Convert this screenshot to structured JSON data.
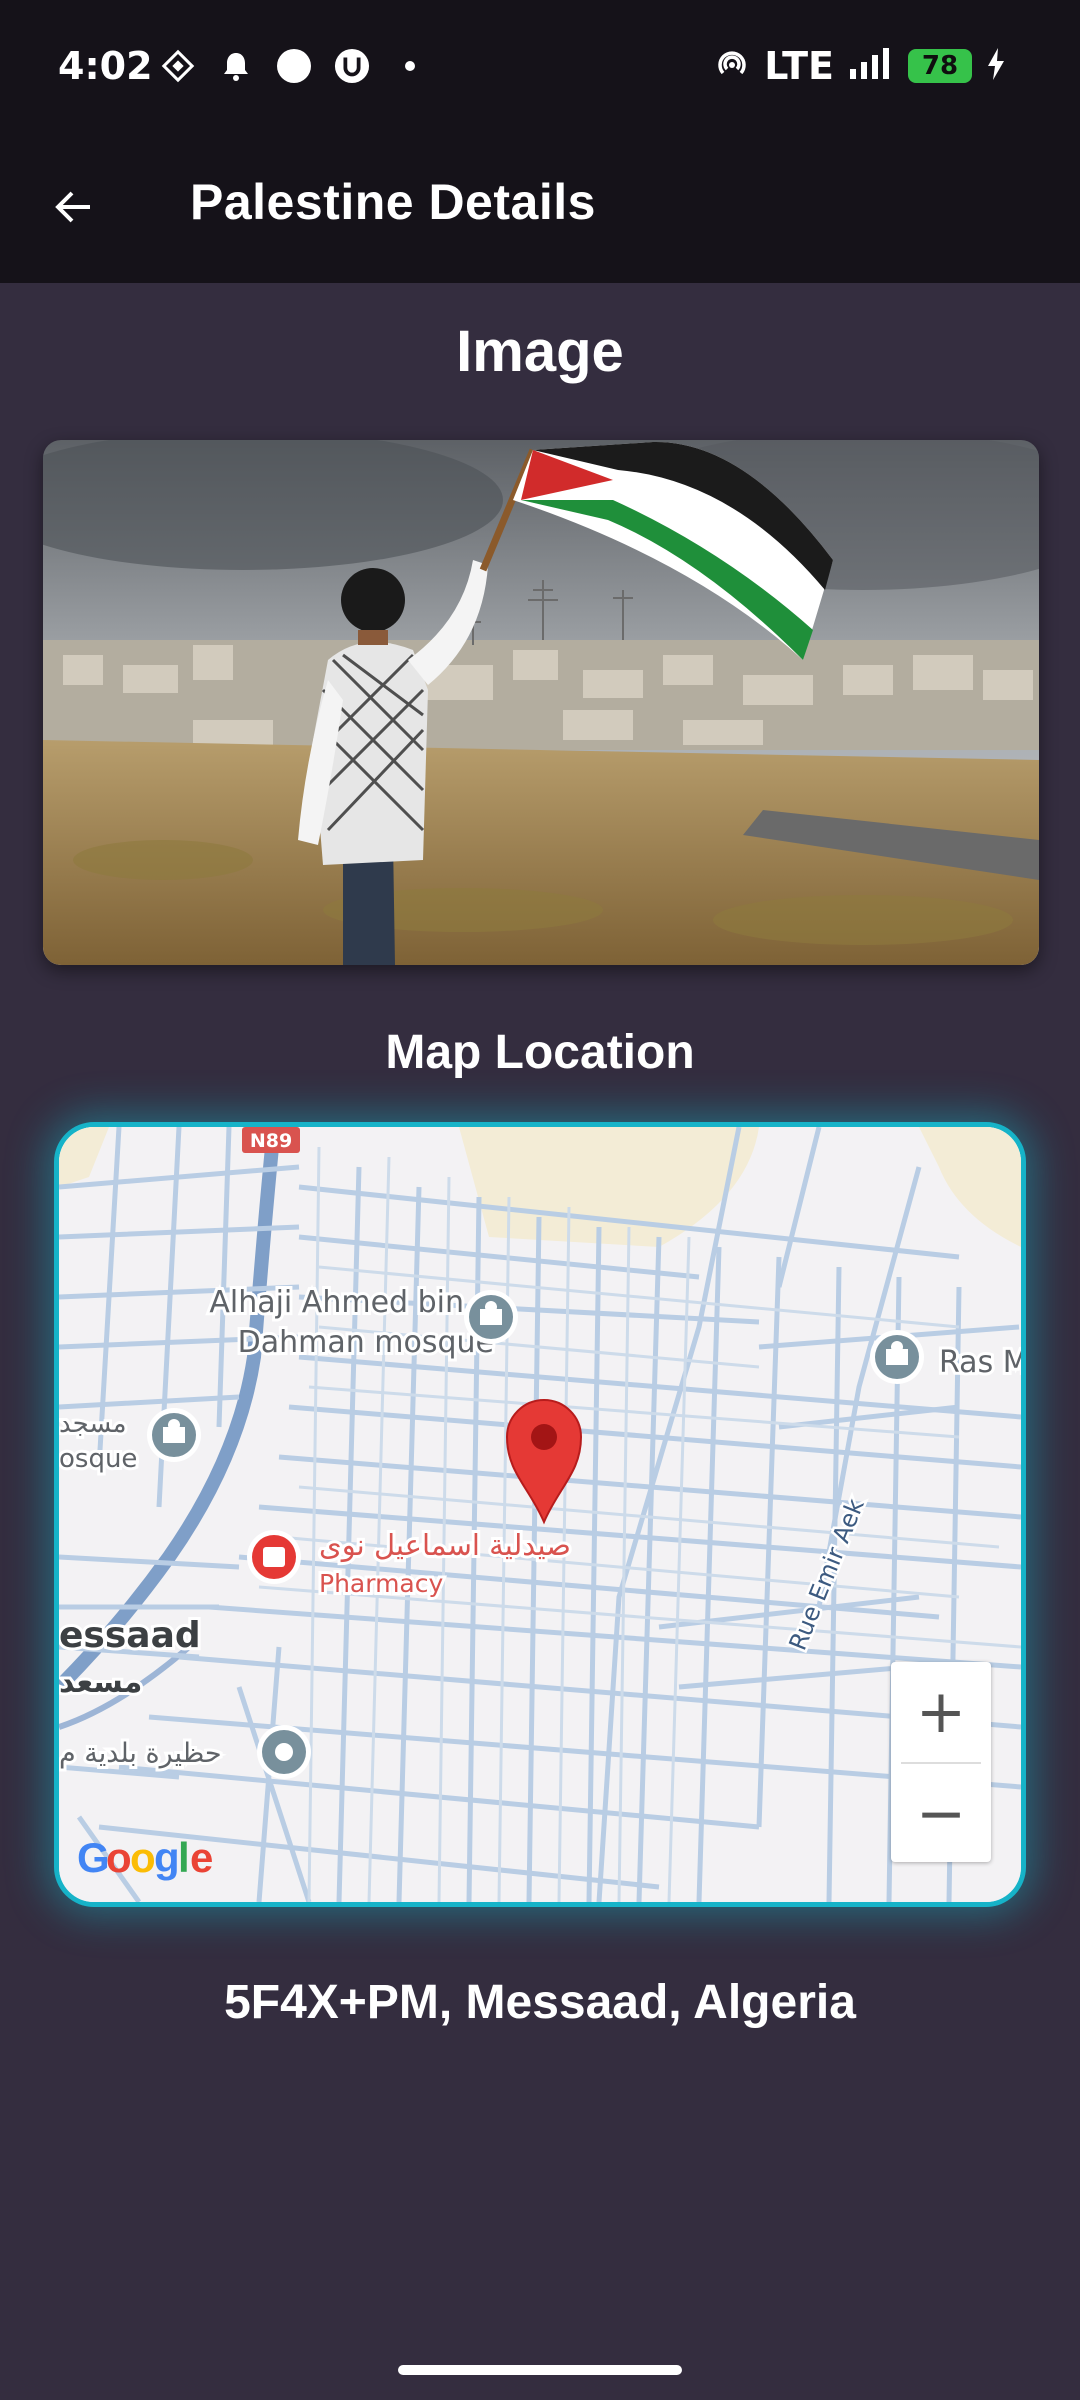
{
  "status_bar": {
    "time": "4:02",
    "network": "LTE",
    "battery": "78",
    "icons": [
      "diamond-icon",
      "bell-icon",
      "circle-icon",
      "u-icon",
      "dot-icon",
      "hotspot-icon",
      "signal-icon",
      "charging-icon"
    ]
  },
  "app_bar": {
    "back_icon": "arrow-left-icon",
    "title": "Palestine  Details"
  },
  "image_section": {
    "title": "Image"
  },
  "map_section": {
    "title": "Map Location",
    "road_badge": "N89",
    "labels": {
      "mosque_1": "Alhaji Ahmed bin",
      "mosque_1b": "Dahman mosque",
      "ras": "Ras M",
      "masjid_left_a": "مسجد",
      "masjid_left_b": "osque",
      "pharmacy_ar": "صيدلية اسماعيل نوى",
      "pharmacy_en": "Pharmacy",
      "city": "essaad",
      "city_ar": "مسعد",
      "hazira": "حظيرة بلدية م",
      "street": "Rue Emir Aek"
    },
    "google": [
      "G",
      "o",
      "o",
      "g",
      "l",
      "e"
    ],
    "zoom_in": "+",
    "zoom_out": "−"
  },
  "address": "5F4X+PM, Messaad, Algeria",
  "colors": {
    "accent": "#16b3c8",
    "background": "#342d3f",
    "bar": "#151219",
    "pin": "#e53935"
  }
}
